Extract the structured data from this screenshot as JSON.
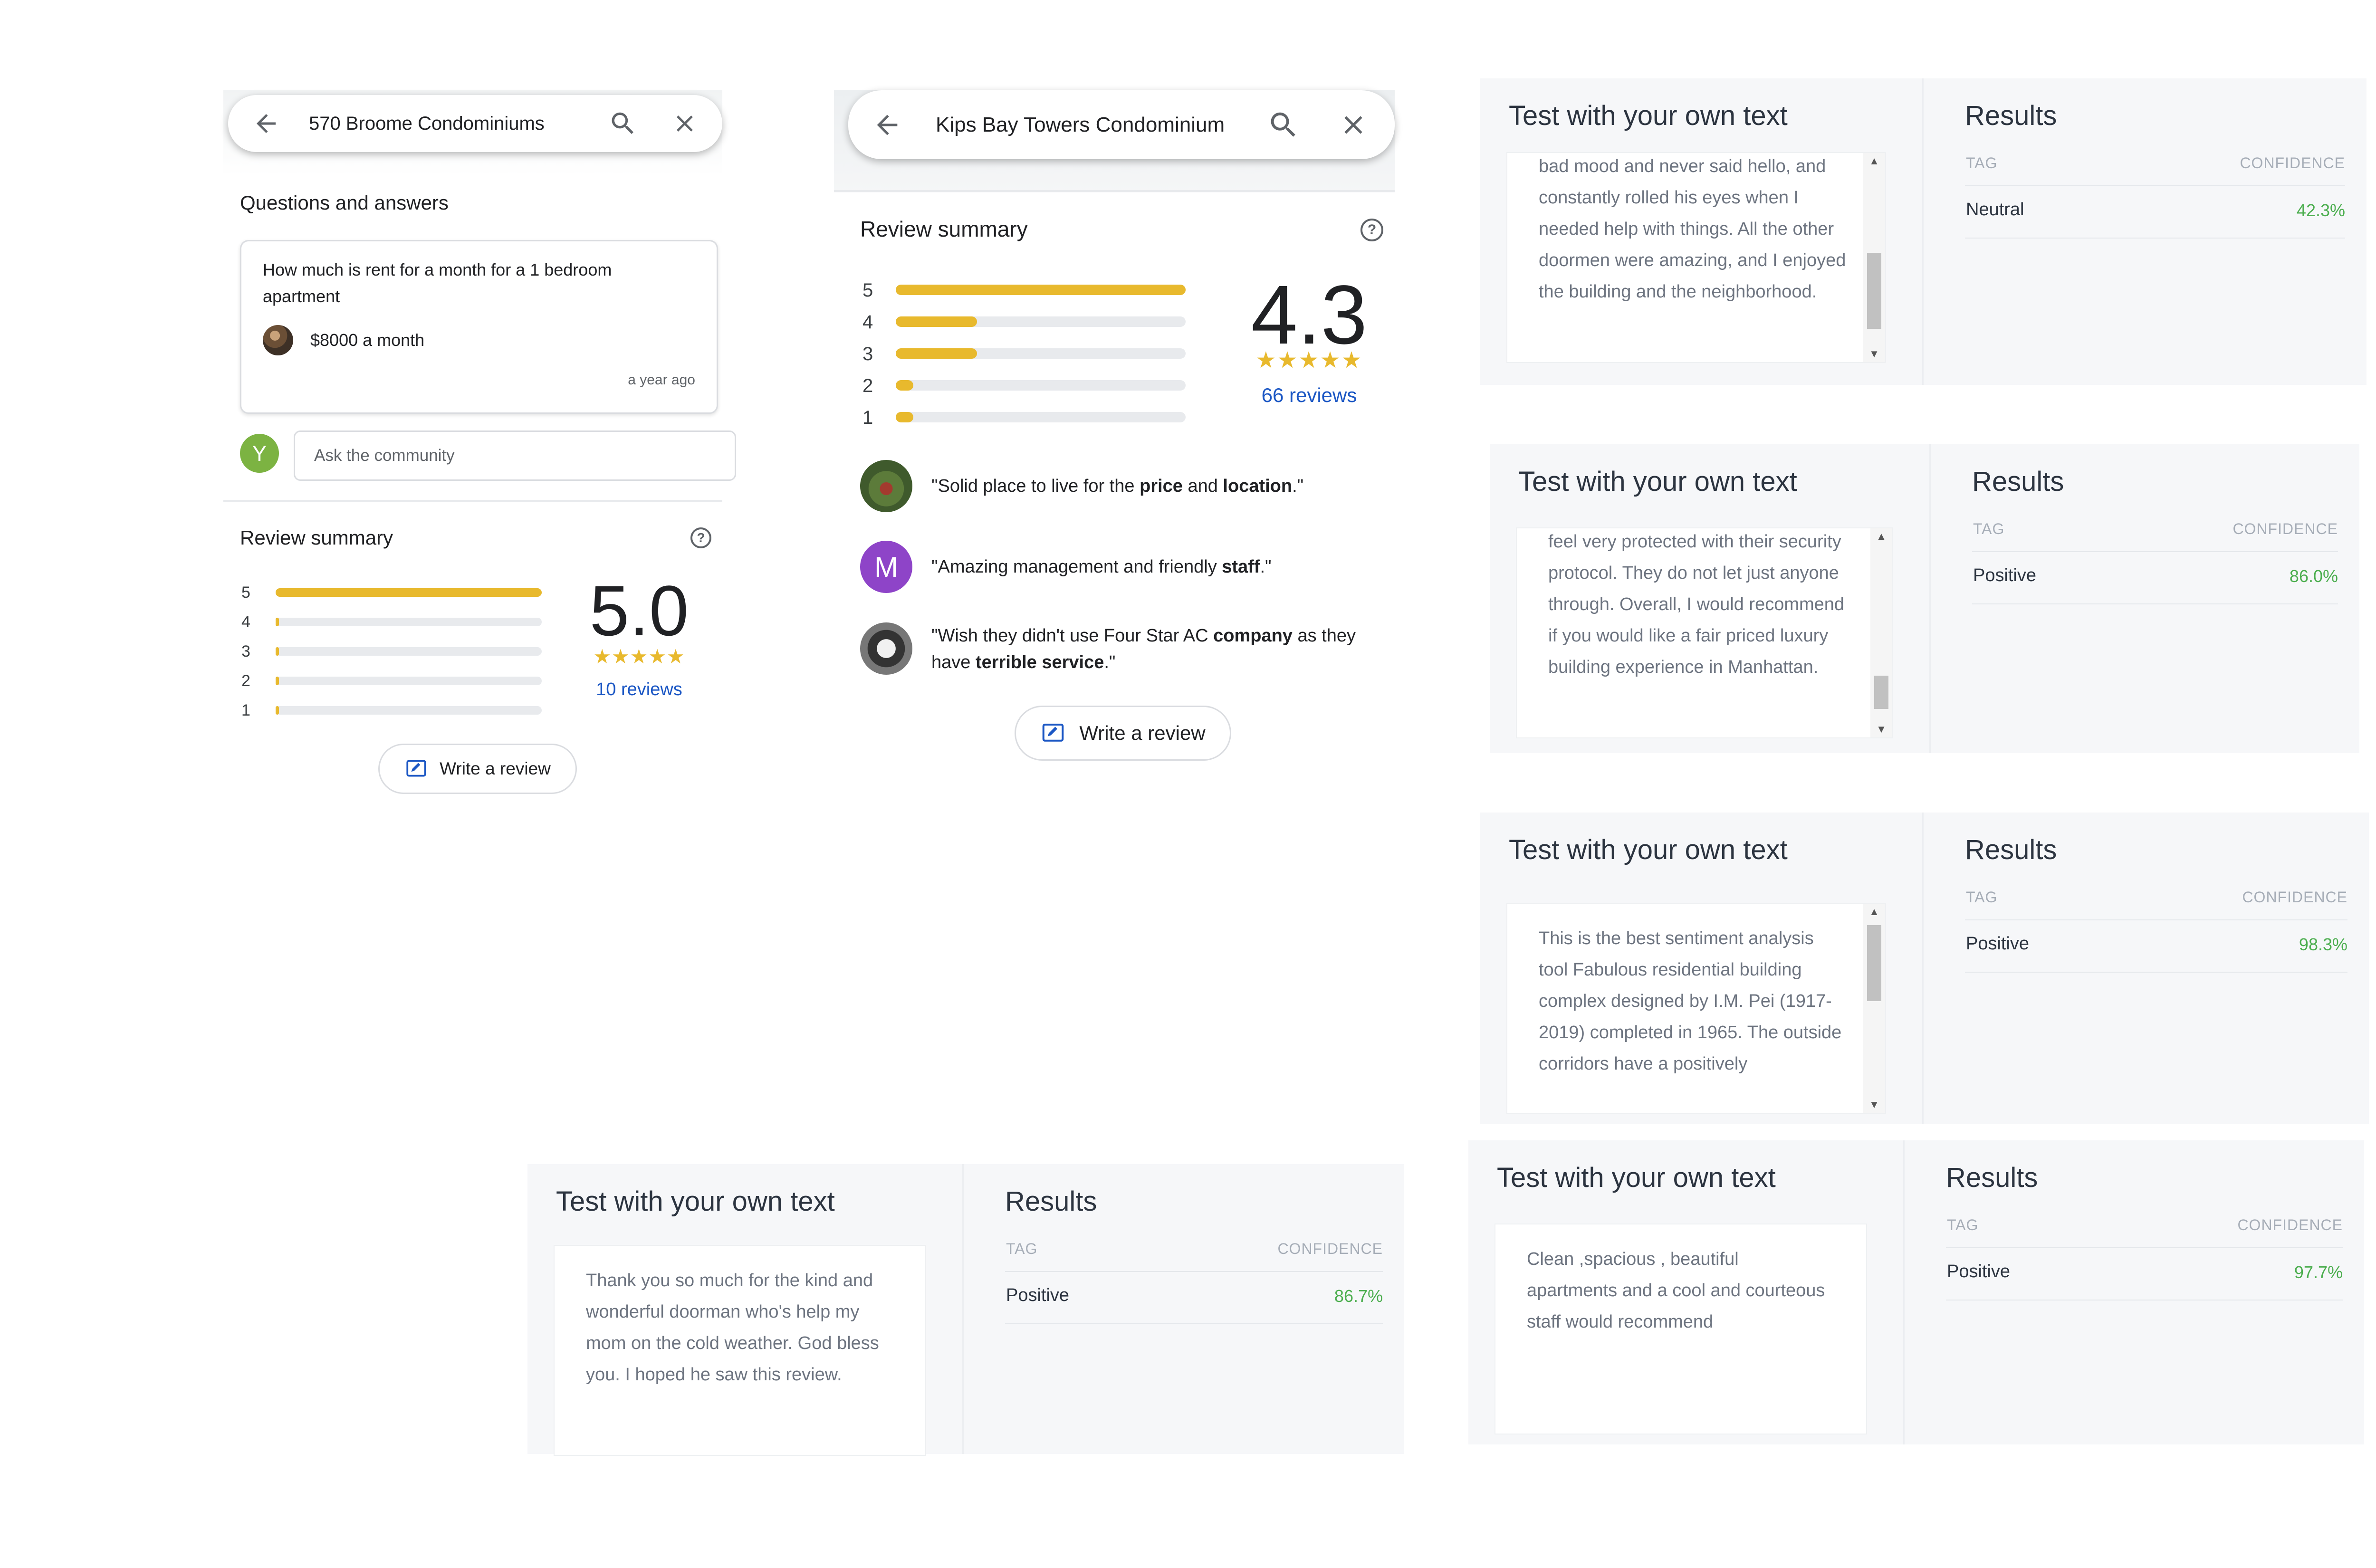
{
  "maps_left": {
    "search_title": "570 Broome Condominiums",
    "qa_heading": "Questions and answers",
    "question": "How much is rent for a month for a 1 bedroom apartment",
    "answer": "$8000 a month",
    "answer_time": "a year ago",
    "ask_avatar_letter": "Y",
    "ask_placeholder": "Ask the community",
    "review_heading": "Review summary",
    "help_glyph": "?",
    "bars": [
      {
        "label": "5",
        "fraction": 1.0
      },
      {
        "label": "4",
        "fraction": 0.01
      },
      {
        "label": "3",
        "fraction": 0.01
      },
      {
        "label": "2",
        "fraction": 0.01
      },
      {
        "label": "1",
        "fraction": 0.01
      }
    ],
    "rating": "5.0",
    "stars": "★★★★★",
    "reviews_count": "10 reviews",
    "write_review": "Write a review"
  },
  "maps_mid": {
    "search_title": "Kips Bay Towers Condominium",
    "review_heading": "Review summary",
    "help_glyph": "?",
    "bars": [
      {
        "label": "5",
        "fraction": 1.0
      },
      {
        "label": "4",
        "fraction": 0.28
      },
      {
        "label": "3",
        "fraction": 0.28
      },
      {
        "label": "2",
        "fraction": 0.06
      },
      {
        "label": "1",
        "fraction": 0.06
      }
    ],
    "rating": "4.3",
    "stars": "★★★★★",
    "reviews_count": "66 reviews",
    "snippets": [
      {
        "pre": "\"Solid place to live for the ",
        "b1": "price",
        "mid": " and ",
        "b2": "location",
        "post": ".\""
      },
      {
        "pre": "\"Amazing management and friendly ",
        "b1": "staff",
        "mid": "",
        "b2": "",
        "post": ".\""
      },
      {
        "pre": "\"Wish they didn't use Four Star AC ",
        "b1": "company",
        "mid": " as they have ",
        "b2": "terrible service",
        "post": ".\""
      }
    ],
    "snippet_avatar_letter": "M",
    "write_review": "Write a review"
  },
  "sentiment_panels": [
    {
      "heading": "Test with your own text",
      "results_heading": "Results",
      "tag_header": "TAG",
      "confidence_header": "CONFIDENCE",
      "text": "bad mood and never said hello, and constantly rolled his eyes when I needed help with things. All the other doormen were amazing, and I enjoyed the building and the neighborhood.",
      "tag": "Neutral",
      "confidence": "42.3%"
    },
    {
      "heading": "Test with your own text",
      "results_heading": "Results",
      "tag_header": "TAG",
      "confidence_header": "CONFIDENCE",
      "text": "feel very protected with their security protocol. They do not let just anyone through. Overall, I would recommend if you would like a fair priced luxury building experience in Manhattan.",
      "tag": "Positive",
      "confidence": "86.0%"
    },
    {
      "heading": "Test with your own text",
      "results_heading": "Results",
      "tag_header": "TAG",
      "confidence_header": "CONFIDENCE",
      "text": "This is the best sentiment analysis tool Fabulous residential building complex designed by I.M. Pei (1917-2019) completed in 1965. The outside corridors have a positively",
      "tag": "Positive",
      "confidence": "98.3%"
    },
    {
      "heading": "Test with your own text",
      "results_heading": "Results",
      "tag_header": "TAG",
      "confidence_header": "CONFIDENCE",
      "text": "Thank you so much for the kind and wonderful doorman who's help my mom on the cold weather. God bless you. I hoped he saw this review.",
      "tag": "Positive",
      "confidence": "86.7%"
    },
    {
      "heading": "Test with your own text",
      "results_heading": "Results",
      "tag_header": "TAG",
      "confidence_header": "CONFIDENCE",
      "text": "Clean ,spacious , beautiful apartments and a cool and courteous staff would recommend",
      "tag": "Positive",
      "confidence": "97.7%"
    }
  ]
}
